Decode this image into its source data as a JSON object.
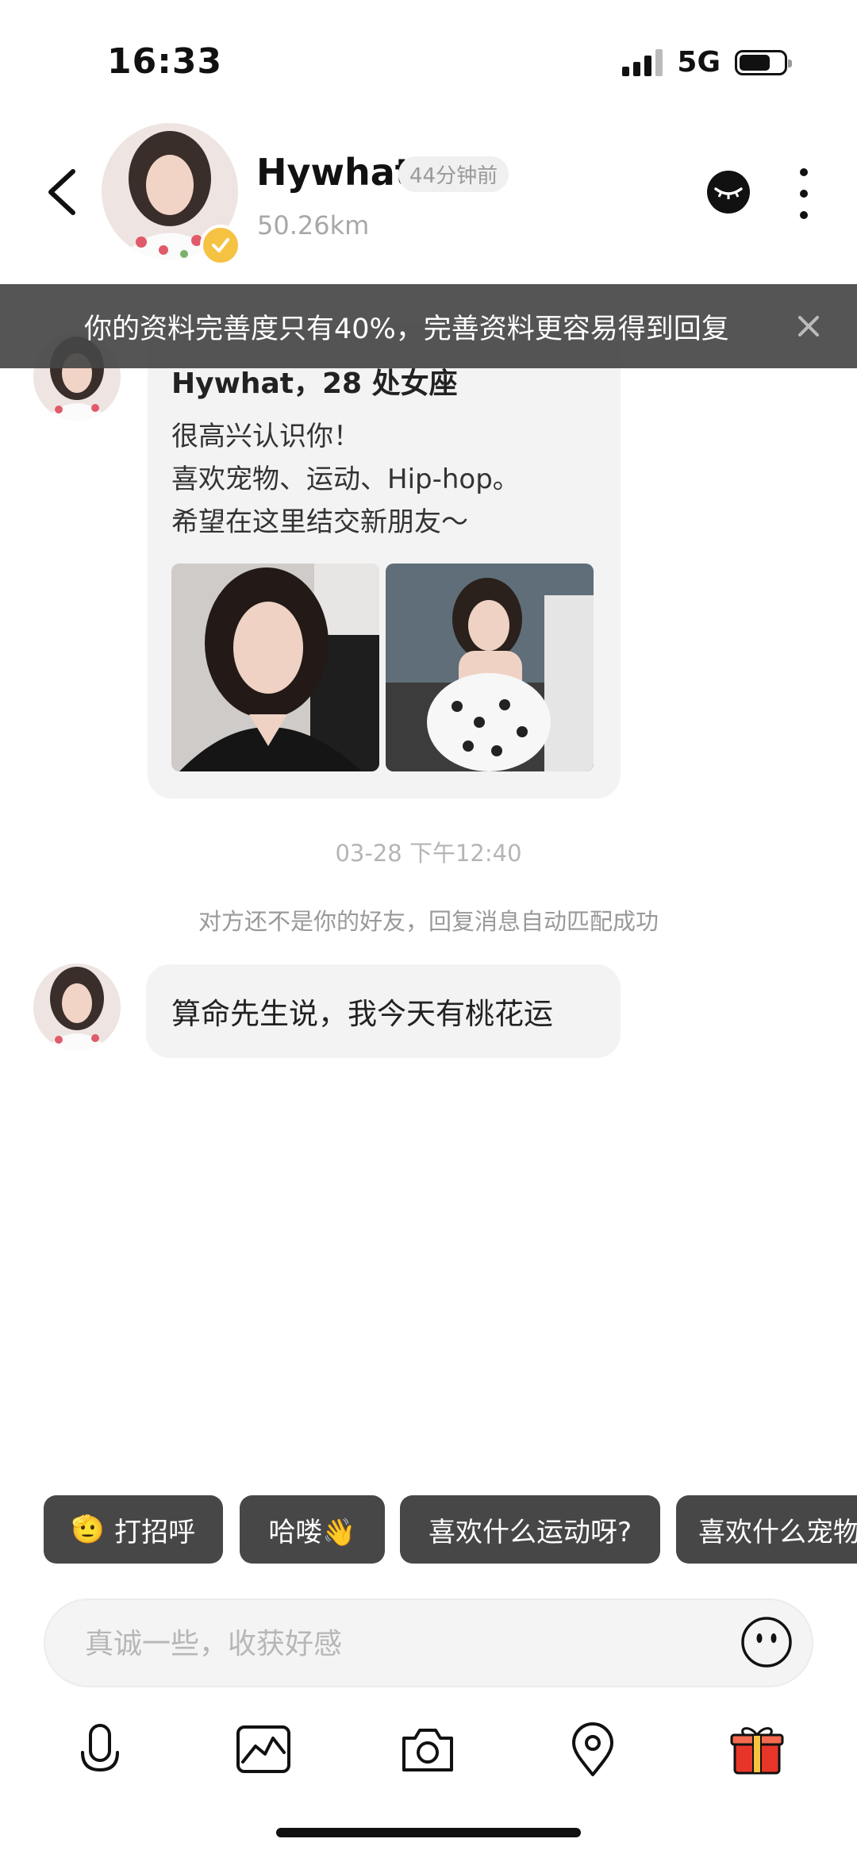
{
  "status_bar": {
    "time": "16:33",
    "network": "5G",
    "battery_percent": 70
  },
  "header": {
    "name": "Hywhat",
    "last_active": "44分钟前",
    "distance": "50.26km"
  },
  "banner": {
    "text": "你的资料完善度只有40%，完善资料更容易得到回复"
  },
  "profile_card": {
    "title": "Hywhat，28 处女座",
    "lines": [
      "很高兴认识你！",
      "喜欢宠物、运动、Hip-hop。",
      "希望在这里结交新朋友～"
    ]
  },
  "timestamp": "03-28 下午12:40",
  "system_message": "对方还不是你的好友，回复消息自动匹配成功",
  "messages": [
    {
      "text": "算命先生说，我今天有桃花运"
    }
  ],
  "quick_replies": [
    {
      "emoji": "🫡",
      "label": "打招呼"
    },
    {
      "label": "哈喽👋"
    },
    {
      "label": "喜欢什么运动呀?"
    },
    {
      "label": "喜欢什么宠物"
    }
  ],
  "input": {
    "placeholder": "真诚一些，收获好感"
  },
  "toolbar": [
    "microphone-icon",
    "image-icon",
    "camera-icon",
    "location-icon",
    "gift-icon"
  ],
  "colors": {
    "banner_bg": "#464646",
    "chip_bg": "#474747",
    "bubble_bg": "#f3f3f3",
    "verify_badge": "#f5c242",
    "gift": "#e8352a"
  }
}
